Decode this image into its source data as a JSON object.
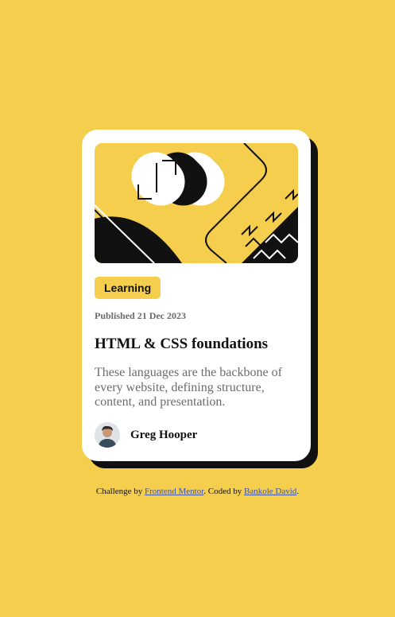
{
  "card": {
    "tag": "Learning",
    "published": "Published 21 Dec 2023",
    "title": "HTML & CSS foundations",
    "description": "These languages are the backbone of every website, defining structure, content, and presentation.",
    "author": {
      "name": "Greg Hooper"
    }
  },
  "attribution": {
    "prefix": "Challenge by ",
    "frontend_mentor_link": "Frontend Mentor",
    "middle": ". Coded by ",
    "author_link": "Bankole David",
    "suffix": "."
  },
  "colors": {
    "background": "#F5CE4D",
    "card": "#FFFFFF",
    "shadow": "#111111",
    "muted_text": "#6B6B6B",
    "link": "#3E52A3"
  }
}
